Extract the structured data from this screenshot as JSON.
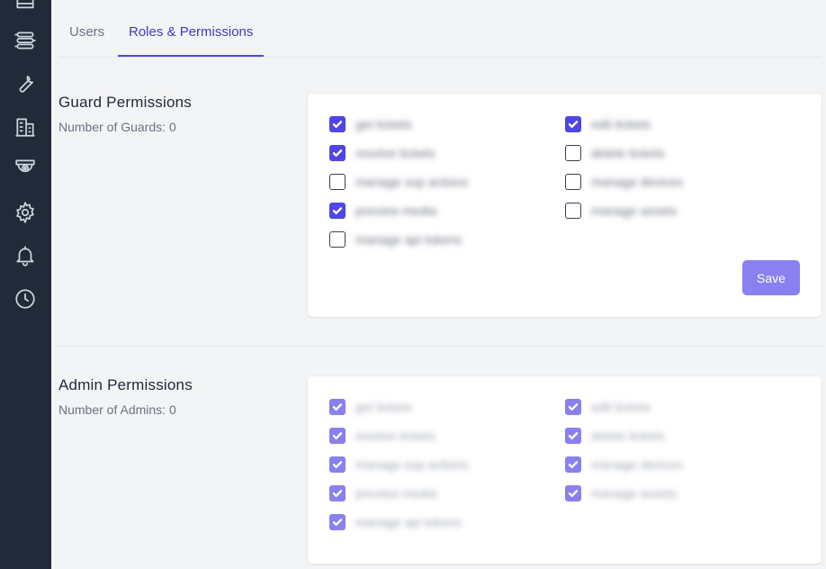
{
  "tabs": [
    {
      "label": "Users",
      "active": false
    },
    {
      "label": "Roles & Permissions",
      "active": true
    }
  ],
  "sidebar": {
    "icons": [
      "tray-icon",
      "routes-icon",
      "wrench-icon",
      "building-icon",
      "camera-icon",
      "gear-icon",
      "bell-icon",
      "clock-icon"
    ]
  },
  "guard": {
    "title": "Guard Permissions",
    "count_text": "Number of Guards: 0",
    "save_label": "Save",
    "permissions": [
      {
        "label": "get tickets",
        "checked": true
      },
      {
        "label": "edit tickets",
        "checked": true
      },
      {
        "label": "resolve tickets",
        "checked": true
      },
      {
        "label": "delete tickets",
        "checked": false
      },
      {
        "label": "manage sop actions",
        "checked": false
      },
      {
        "label": "manage devices",
        "checked": false
      },
      {
        "label": "preview media",
        "checked": true
      },
      {
        "label": "manage assets",
        "checked": false
      },
      {
        "label": "manage api tokens",
        "checked": false
      }
    ]
  },
  "admin": {
    "title": "Admin Permissions",
    "count_text": "Number of Admins: 0",
    "permissions": [
      {
        "label": "get tickets",
        "checked": true
      },
      {
        "label": "edit tickets",
        "checked": true
      },
      {
        "label": "resolve tickets",
        "checked": true
      },
      {
        "label": "delete tickets",
        "checked": true
      },
      {
        "label": "manage sop actions",
        "checked": true
      },
      {
        "label": "manage devices",
        "checked": true
      },
      {
        "label": "preview media",
        "checked": true
      },
      {
        "label": "manage assets",
        "checked": true
      },
      {
        "label": "manage api tokens",
        "checked": true
      }
    ]
  },
  "colors": {
    "accent": "#4f46e5",
    "accent_disabled": "#8b80f0",
    "sidebar_bg": "#222a3a"
  }
}
